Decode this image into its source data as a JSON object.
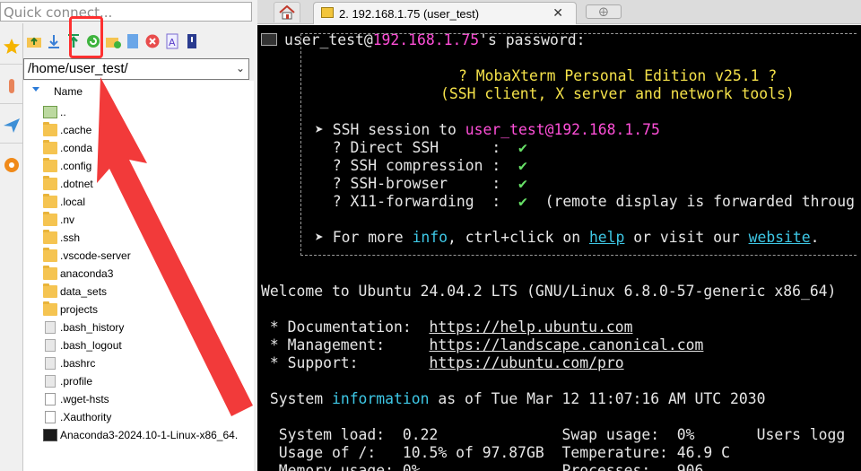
{
  "sidebar": {
    "quick_connect_placeholder": "Quick connect...",
    "path": "/home/user_test/",
    "column_name": "Name",
    "files": [
      {
        "name": "..",
        "type": "up"
      },
      {
        "name": ".cache",
        "type": "folder"
      },
      {
        "name": ".conda",
        "type": "folder"
      },
      {
        "name": ".config",
        "type": "folder"
      },
      {
        "name": ".dotnet",
        "type": "folder"
      },
      {
        "name": ".local",
        "type": "folder"
      },
      {
        "name": ".nv",
        "type": "folder"
      },
      {
        "name": ".ssh",
        "type": "folder"
      },
      {
        "name": ".vscode-server",
        "type": "folder"
      },
      {
        "name": "anaconda3",
        "type": "folder"
      },
      {
        "name": "data_sets",
        "type": "folder"
      },
      {
        "name": "projects",
        "type": "folder"
      },
      {
        "name": ".bash_history",
        "type": "file"
      },
      {
        "name": ".bash_logout",
        "type": "file"
      },
      {
        "name": ".bashrc",
        "type": "file"
      },
      {
        "name": ".profile",
        "type": "file"
      },
      {
        "name": ".wget-hsts",
        "type": "file-white"
      },
      {
        "name": ".Xauthority",
        "type": "file-white"
      },
      {
        "name": "Anaconda3-2024.10-1-Linux-x86_64.",
        "type": "script"
      }
    ],
    "toolbar_icons": [
      "folder-up-icon",
      "download-icon",
      "upload-icon",
      "refresh-icon",
      "new-folder-icon",
      "new-file-icon",
      "delete-icon",
      "rename-icon",
      "settings-icon"
    ]
  },
  "tabs": {
    "active_tab": "2. 192.168.1.75 (user_test)",
    "close_glyph": "✕"
  },
  "terminal": {
    "user": "user_test",
    "host": "192.168.1.75",
    "password_prompt": "'s password:",
    "banner_title": "? MobaXterm Personal Edition v25.1 ?",
    "banner_subtitle": "(SSH client, X server and network tools)",
    "session_prefix": "➤ SSH session to ",
    "session_target": "user_test@192.168.1.75",
    "checks": [
      {
        "label": "  ? Direct SSH      :  ",
        "mark": "✔",
        "note": ""
      },
      {
        "label": "  ? SSH compression :  ",
        "mark": "✔",
        "note": ""
      },
      {
        "label": "  ? SSH-browser     :  ",
        "mark": "✔",
        "note": ""
      },
      {
        "label": "  ? X11-forwarding  :  ",
        "mark": "✔",
        "note": "  (remote display is forwarded throug"
      }
    ],
    "more_prefix": "➤ For more ",
    "more_info": "info",
    "more_mid": ", ctrl+click on ",
    "more_help": "help",
    "more_or": " or visit our ",
    "more_website": "website",
    "more_end": ".",
    "welcome": "Welcome to Ubuntu 24.04.2 LTS (GNU/Linux 6.8.0-57-generic x86_64)",
    "doc_label": " * Documentation:  ",
    "doc_url": "https://help.ubuntu.com",
    "mgmt_label": " * Management:     ",
    "mgmt_url": "https://landscape.canonical.com",
    "support_label": " * Support:        ",
    "support_url": "https://ubuntu.com/pro",
    "sysinfo_prefix": " System ",
    "sysinfo_word": "information",
    "sysinfo_suffix": " as of Tue Mar 12 11:07:16 AM UTC 2030",
    "stat_line1": "  System load:  0.22              Swap usage:  0%       Users logg",
    "stat_line2": "  Usage of /:   10.5% of 97.87GB  Temperature: 46.9 C",
    "stat_line3": "  Memory usage: 0%                Processes:   906"
  },
  "colors": {
    "host_magenta": "#ff4fd8",
    "link_cyan": "#3ec8e6",
    "banner_yellow": "#f5e24a",
    "check_green": "#67e067",
    "annotation_red": "#ff3030"
  }
}
